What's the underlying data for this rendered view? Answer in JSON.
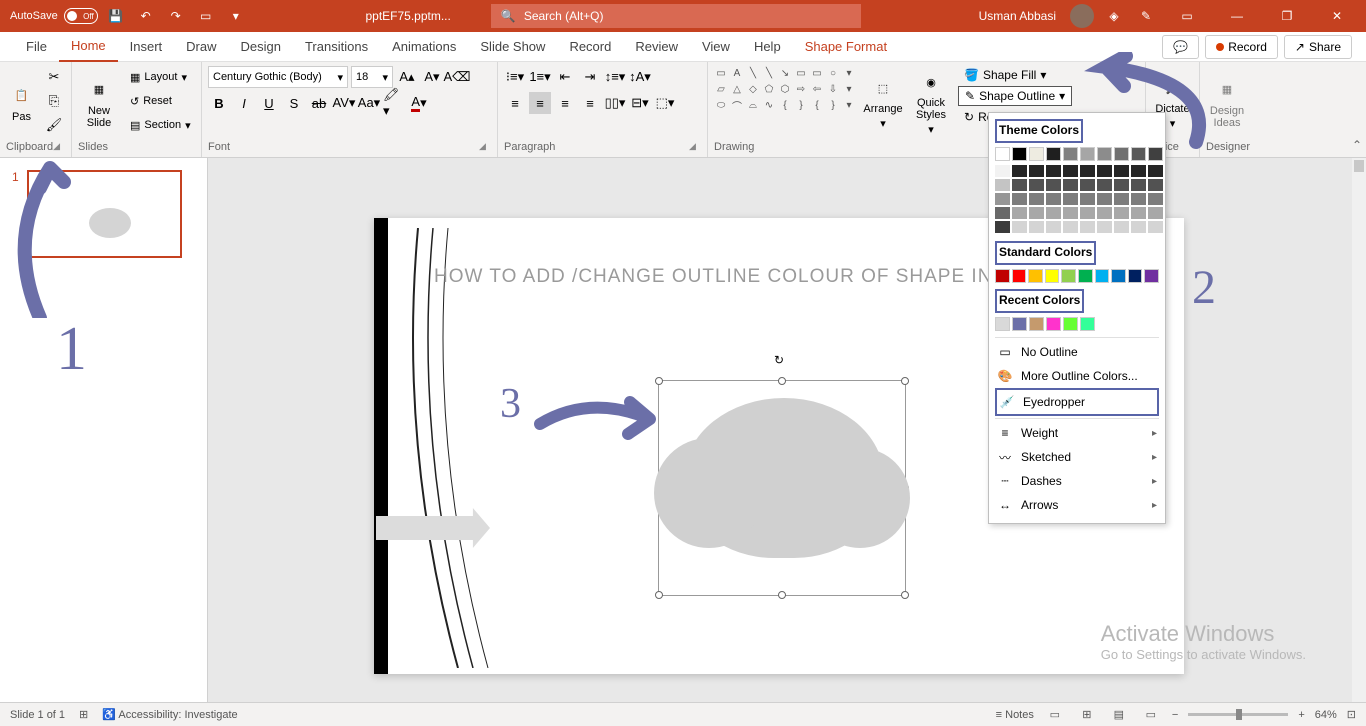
{
  "titlebar": {
    "autosave_label": "AutoSave",
    "autosave_state": "Off",
    "filename": "pptEF75.pptm...",
    "search_placeholder": "Search (Alt+Q)",
    "user_name": "Usman Abbasi"
  },
  "tabs": {
    "file": "File",
    "home": "Home",
    "insert": "Insert",
    "draw": "Draw",
    "design": "Design",
    "transitions": "Transitions",
    "animations": "Animations",
    "slideshow": "Slide Show",
    "record": "Record",
    "review": "Review",
    "view": "View",
    "help": "Help",
    "shapeformat": "Shape Format"
  },
  "ribbon_right": {
    "record": "Record",
    "share": "Share"
  },
  "groups": {
    "clipboard": "Clipboard",
    "slides": "Slides",
    "font": "Font",
    "paragraph": "Paragraph",
    "drawing": "Drawing",
    "voice": "Voice",
    "designer": "Designer"
  },
  "clipboard": {
    "paste": "Pas"
  },
  "slides": {
    "new_slide": "New\nSlide",
    "layout": "Layout",
    "reset": "Reset",
    "section": "Section"
  },
  "font": {
    "name": "Century Gothic (Body)",
    "size": "18"
  },
  "drawing": {
    "arrange": "Arrange",
    "quick_styles": "Quick\nStyles",
    "shape_fill": "Shape Fill",
    "shape_outline": "Shape Outline",
    "replace": "Replace"
  },
  "voice": {
    "dictate": "Dictate"
  },
  "designer": {
    "design_ideas": "Design\nIdeas"
  },
  "outline_dropdown": {
    "theme_header": "Theme Colors",
    "standard_header": "Standard Colors",
    "recent_header": "Recent Colors",
    "no_outline": "No Outline",
    "more_colors": "More Outline Colors...",
    "eyedropper": "Eyedropper",
    "weight": "Weight",
    "sketched": "Sketched",
    "dashes": "Dashes",
    "arrows": "Arrows",
    "theme_main": [
      "#ffffff",
      "#000000",
      "#eeece1",
      "#1f1f1f",
      "#808080",
      "#a6a6a6",
      "#8c8c8c",
      "#707070",
      "#595959",
      "#404040"
    ],
    "standard": [
      "#c00000",
      "#ff0000",
      "#ffc000",
      "#ffff00",
      "#92d050",
      "#00b050",
      "#00b0f0",
      "#0070c0",
      "#002060",
      "#7030a0"
    ],
    "recent": [
      "#d9d9d9",
      "#6b6fa8",
      "#c59a6d",
      "#ff33cc",
      "#66ff33",
      "#33ff99"
    ]
  },
  "slide": {
    "title": "HOW TO ADD /CHANGE OUTLINE COLOUR OF SHAPE IN P"
  },
  "annotation": {
    "one": "1",
    "two": "2",
    "three": "3"
  },
  "status": {
    "slide": "Slide 1 of 1",
    "accessibility": "Accessibility: Investigate",
    "notes": "Notes",
    "zoom": "64%"
  },
  "watermark": {
    "title": "Activate Windows",
    "sub": "Go to Settings to activate Windows."
  },
  "thumb_num": "1"
}
